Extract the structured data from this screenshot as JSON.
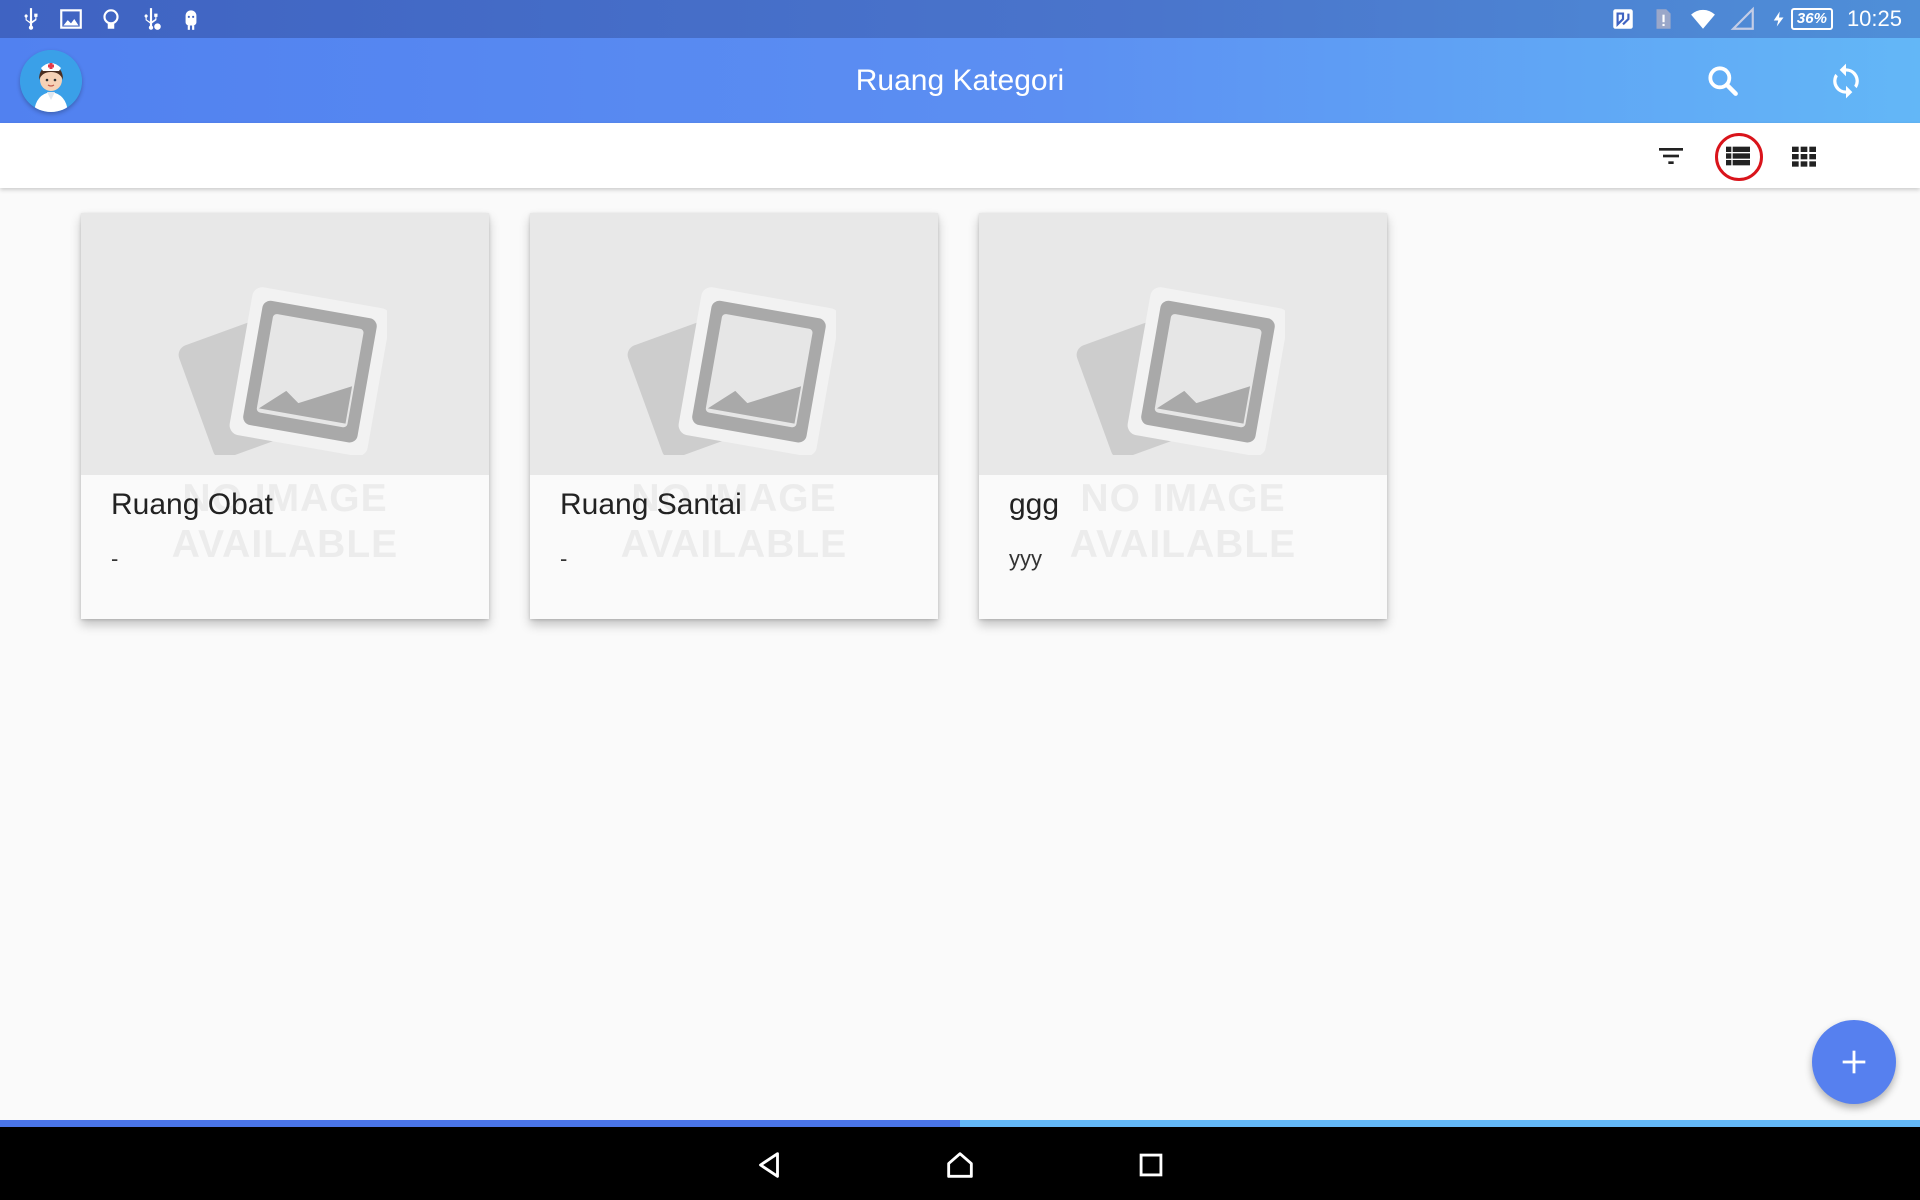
{
  "status_bar": {
    "left_icons": [
      "usb-icon",
      "image-icon",
      "lightbulb-icon",
      "usb-debug-icon",
      "android-icon"
    ],
    "right_icons": [
      "nfc-icon",
      "sim-alert-icon",
      "wifi-icon",
      "signal-icon",
      "charging-icon"
    ],
    "battery": "36%",
    "time": "10:25"
  },
  "app_bar": {
    "title": "Ruang Kategori",
    "actions": [
      "search-icon",
      "sync-icon"
    ]
  },
  "toolbar": {
    "actions": [
      "filter-icon",
      "list-view-icon",
      "grid-view-icon"
    ],
    "active": "list-view-icon"
  },
  "placeholder": {
    "line1": "NO IMAGE",
    "line2": "AVAILABLE"
  },
  "cards": [
    {
      "title": "Ruang Obat",
      "subtitle": "-"
    },
    {
      "title": "Ruang Santai",
      "subtitle": "-"
    },
    {
      "title": "ggg",
      "subtitle": "yyy"
    }
  ],
  "fab": {
    "icon": "plus-icon"
  },
  "progress": {
    "fraction": 0.5
  },
  "nav_bar": {
    "buttons": [
      "back-icon",
      "home-icon",
      "recents-icon"
    ]
  },
  "colors": {
    "app_bar_start": "#5181f0",
    "app_bar_end": "#63b7f7",
    "accent": "#5680ef",
    "active_ring": "#d9141b"
  }
}
